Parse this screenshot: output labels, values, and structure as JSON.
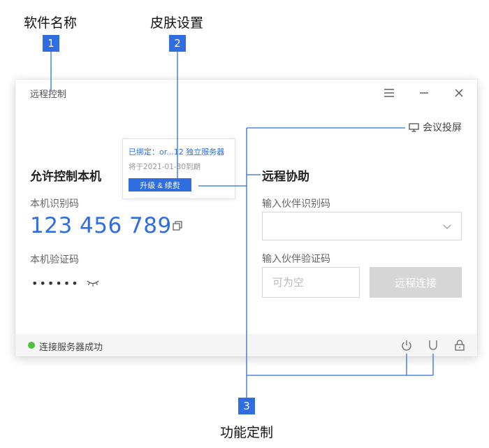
{
  "callouts": {
    "c1": {
      "number": "1",
      "title": "软件名称"
    },
    "c2": {
      "number": "2",
      "title": "皮肤设置"
    },
    "c3": {
      "number": "3",
      "title": "功能定制"
    }
  },
  "window": {
    "title": "远程控制",
    "controls": [
      "menu-icon",
      "minimize-icon",
      "close-icon"
    ]
  },
  "cast": {
    "label": "会议投屏",
    "icon": "monitor-icon"
  },
  "popup": {
    "line1": "已绑定：or...12 独立服务器",
    "line2": "将于2021-01-30到期",
    "button": "升级 & 续费"
  },
  "local": {
    "title": "允许控制本机",
    "id_label": "本机识别码",
    "id_value": "123 456 789",
    "code_label": "本机验证码",
    "code_value": "••••••"
  },
  "remote": {
    "title": "远程协助",
    "partner_id_label": "输入伙伴识别码",
    "partner_id_value": "",
    "partner_code_label": "输入伙伴验证码",
    "partner_code_placeholder": "可为空",
    "connect_button": "远程连接"
  },
  "status": {
    "text": "连接服务器成功",
    "color": "#4cc23c"
  },
  "colors": {
    "accent": "#2f6de1",
    "disabled": "#d6d6d6"
  }
}
